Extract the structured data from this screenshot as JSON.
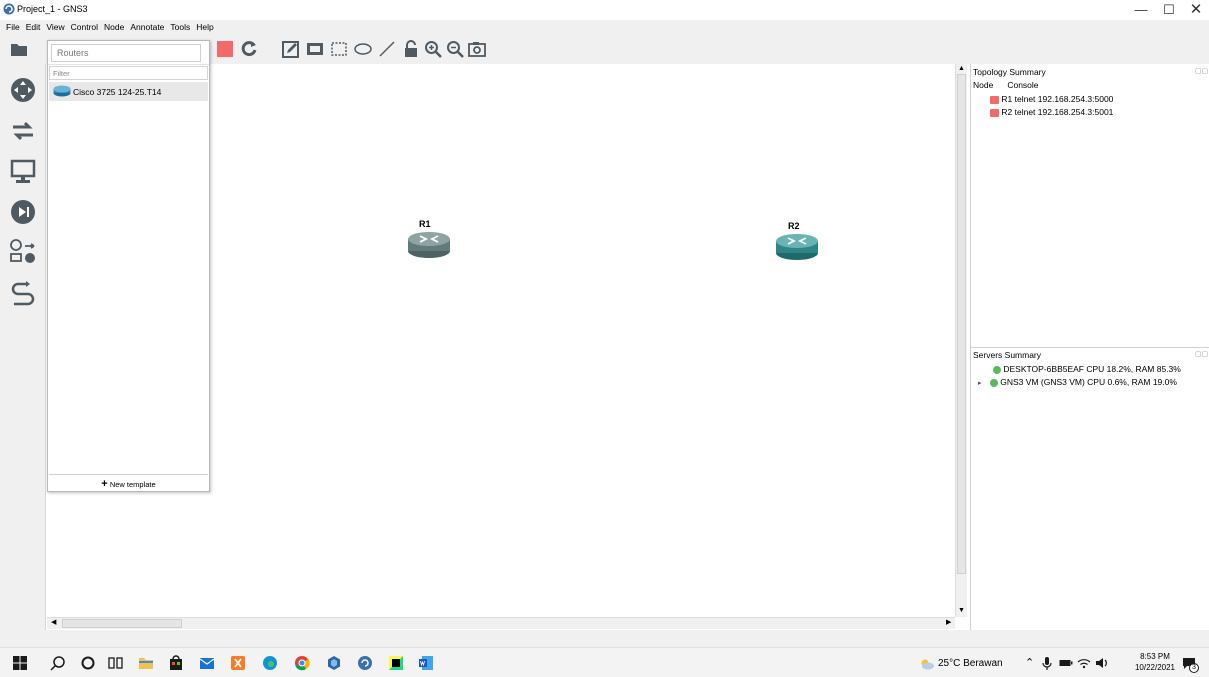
{
  "window": {
    "title": "Project_1 - GNS3",
    "minimize": "—",
    "maximize": "☐",
    "close": "✕"
  },
  "menu": [
    "File",
    "Edit",
    "View",
    "Control",
    "Node",
    "Annotate",
    "Tools",
    "Help"
  ],
  "routers_panel": {
    "category": "Routers",
    "filter_placeholder": "Filter",
    "devices": [
      "Cisco 3725 124-25.T14"
    ],
    "new_template": "New template"
  },
  "topology_nodes": [
    {
      "name": "R1"
    },
    {
      "name": "R2"
    }
  ],
  "topology_summary": {
    "title": "Topology Summary",
    "columns": [
      "Node",
      "Console"
    ],
    "rows": [
      {
        "node": "R1",
        "console": "telnet 192.168.254.3:5000"
      },
      {
        "node": "R2",
        "console": "telnet 192.168.254.3:5001"
      }
    ]
  },
  "servers_summary": {
    "title": "Servers Summary",
    "rows": [
      {
        "text": "DESKTOP-6BB5EAF CPU 18.2%, RAM 85.3%",
        "expander": ""
      },
      {
        "text": "GNS3 VM (GNS3 VM) CPU 0.6%, RAM 19.0%",
        "expander": "▸"
      }
    ]
  },
  "taskbar": {
    "weather": "25°C  Berawan",
    "time": "8:53 PM",
    "date": "10/22/2021",
    "notification_count": "3"
  },
  "colors": {
    "router_gray": "#627a7a",
    "router_teal": "#2e8585",
    "accent_red": "#f26a6a"
  }
}
